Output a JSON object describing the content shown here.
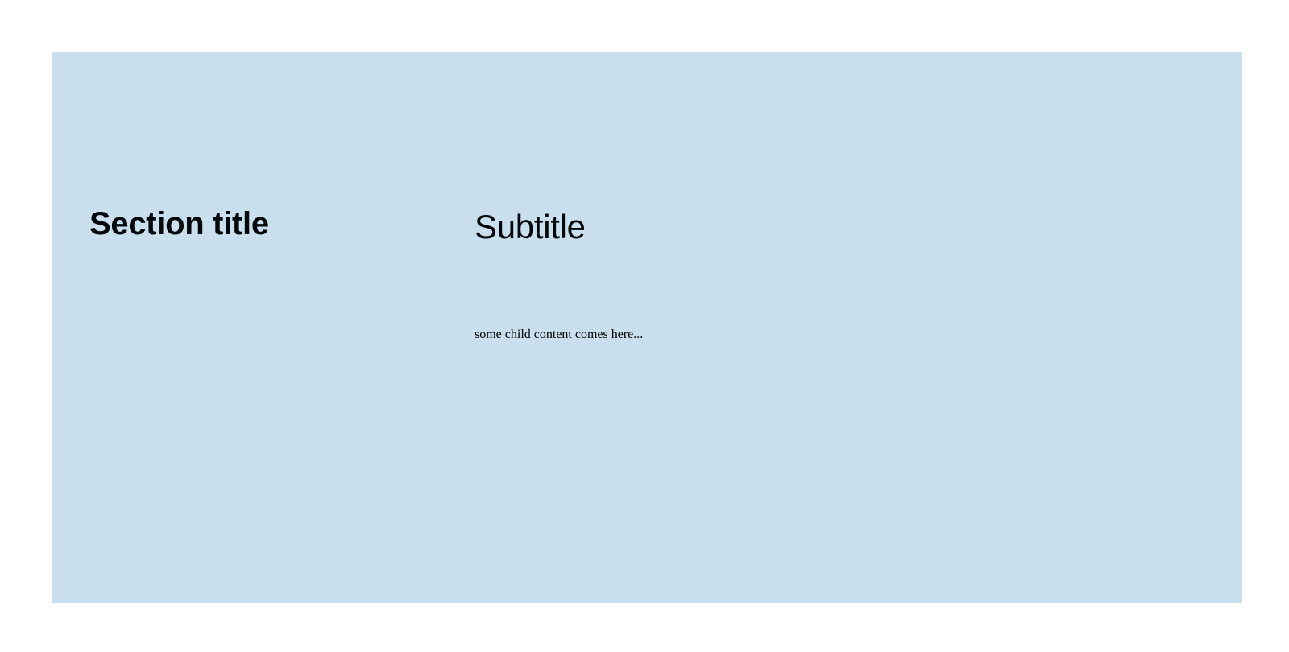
{
  "section": {
    "title": "Section title",
    "subtitle": "Subtitle",
    "child_content": "some child content comes here...",
    "background_color": "#c9dfee"
  }
}
